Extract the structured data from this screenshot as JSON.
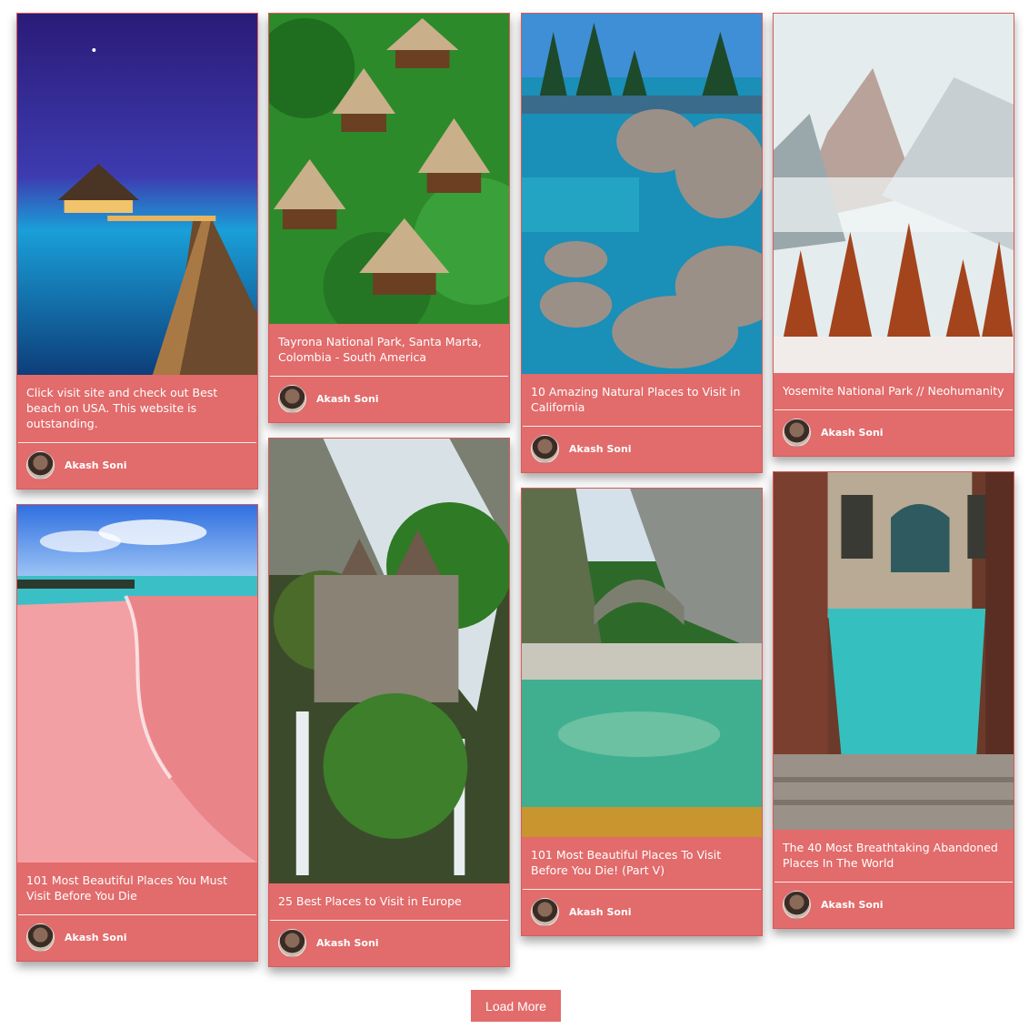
{
  "columns": [
    [
      {
        "title": "Click visit site and check out Best beach on USA. This website is outstanding.",
        "author": "Akash Soni",
        "image": "night-beach-pier-photo"
      },
      {
        "title": "101 Most Beautiful Places You Must Visit Before You Die",
        "author": "Akash Soni",
        "image": "pink-sand-beach-photo"
      }
    ],
    [
      {
        "title": "Tayrona National Park, Santa Marta, Colombia - South America",
        "author": "Akash Soni",
        "image": "jungle-huts-photo"
      },
      {
        "title": "25 Best Places to Visit in Europe",
        "author": "Akash Soni",
        "image": "waterfall-castle-photo"
      }
    ],
    [
      {
        "title": "10 Amazing Natural Places to Visit in California",
        "author": "Akash Soni",
        "image": "lake-boulders-photo"
      },
      {
        "title": "101 Most Beautiful Places To Visit Before You Die! (Part V)",
        "author": "Akash Soni",
        "image": "stone-bridge-river-photo"
      }
    ],
    [
      {
        "title": "Yosemite National Park // Neohumanity",
        "author": "Akash Soni",
        "image": "snowy-mountain-forest-photo"
      },
      {
        "title": "The 40 Most Breathtaking Abandoned Places In The World",
        "author": "Akash Soni",
        "image": "abandoned-canal-photo"
      }
    ]
  ],
  "load_more_label": "Load More",
  "colors": {
    "card": "#e26b6b",
    "text": "#ffffff",
    "background": "#ffffff"
  }
}
